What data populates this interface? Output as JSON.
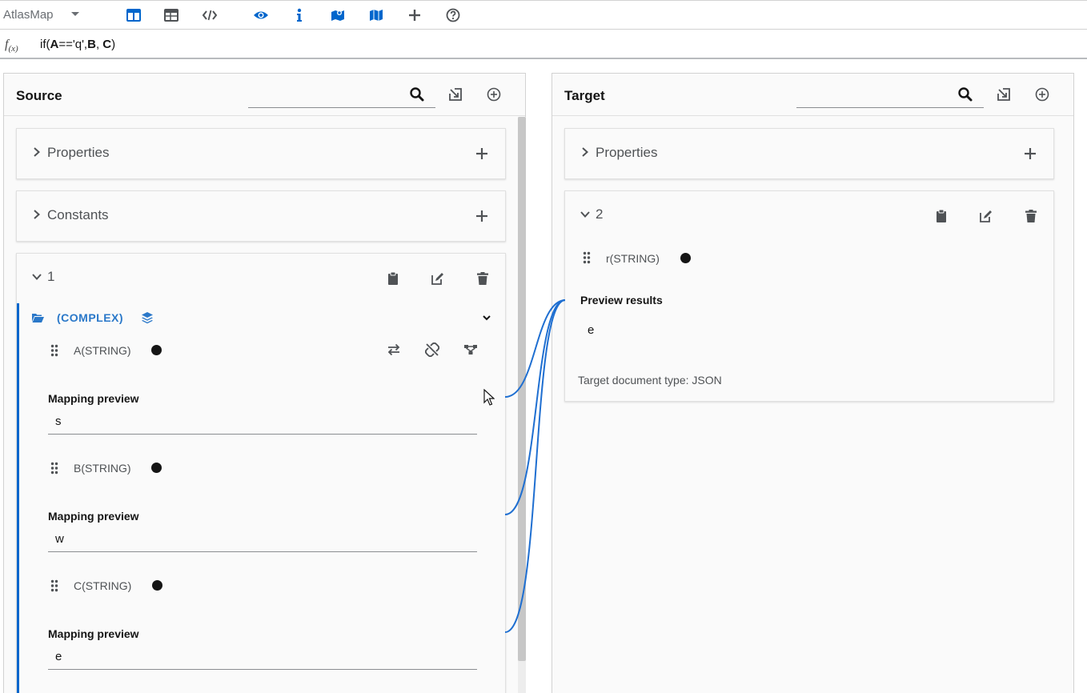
{
  "toolbar": {
    "app_name": "AtlasMap",
    "icons": [
      "columns-view-icon",
      "table-view-icon",
      "code-icon",
      "eye-icon",
      "info-icon",
      "mapped-fields-icon",
      "map-icon",
      "add-icon",
      "help-icon"
    ],
    "accent": "#0066cc"
  },
  "expression": {
    "fx_label": "f",
    "fx_sub": "(x)",
    "prefix": "if(",
    "a": "A",
    "op": "=='q',",
    "b": "B",
    "sep": ", ",
    "c": "C",
    "suffix": ")"
  },
  "source": {
    "title": "Source",
    "search_placeholder": "",
    "sections": [
      {
        "label": "Properties"
      },
      {
        "label": "Constants"
      }
    ],
    "document": {
      "number": "1",
      "group_label": "(COMPLEX)",
      "fields": [
        {
          "label": "A(STRING)",
          "preview_label": "Mapping preview",
          "preview_value": "s"
        },
        {
          "label": "B(STRING)",
          "preview_label": "Mapping preview",
          "preview_value": "w"
        },
        {
          "label": "C(STRING)",
          "preview_label": "Mapping preview",
          "preview_value": "e"
        }
      ]
    }
  },
  "target": {
    "title": "Target",
    "search_placeholder": "",
    "sections": [
      {
        "label": "Properties"
      }
    ],
    "document": {
      "number": "2",
      "field_label": "r(STRING)",
      "results_label": "Preview results",
      "results_value": "e",
      "doc_type": "Target document type: JSON"
    }
  },
  "colors": {
    "link_line": "#1f6fd1",
    "complex_text": "#2a78c9",
    "selection_bar": "#0066cc"
  }
}
